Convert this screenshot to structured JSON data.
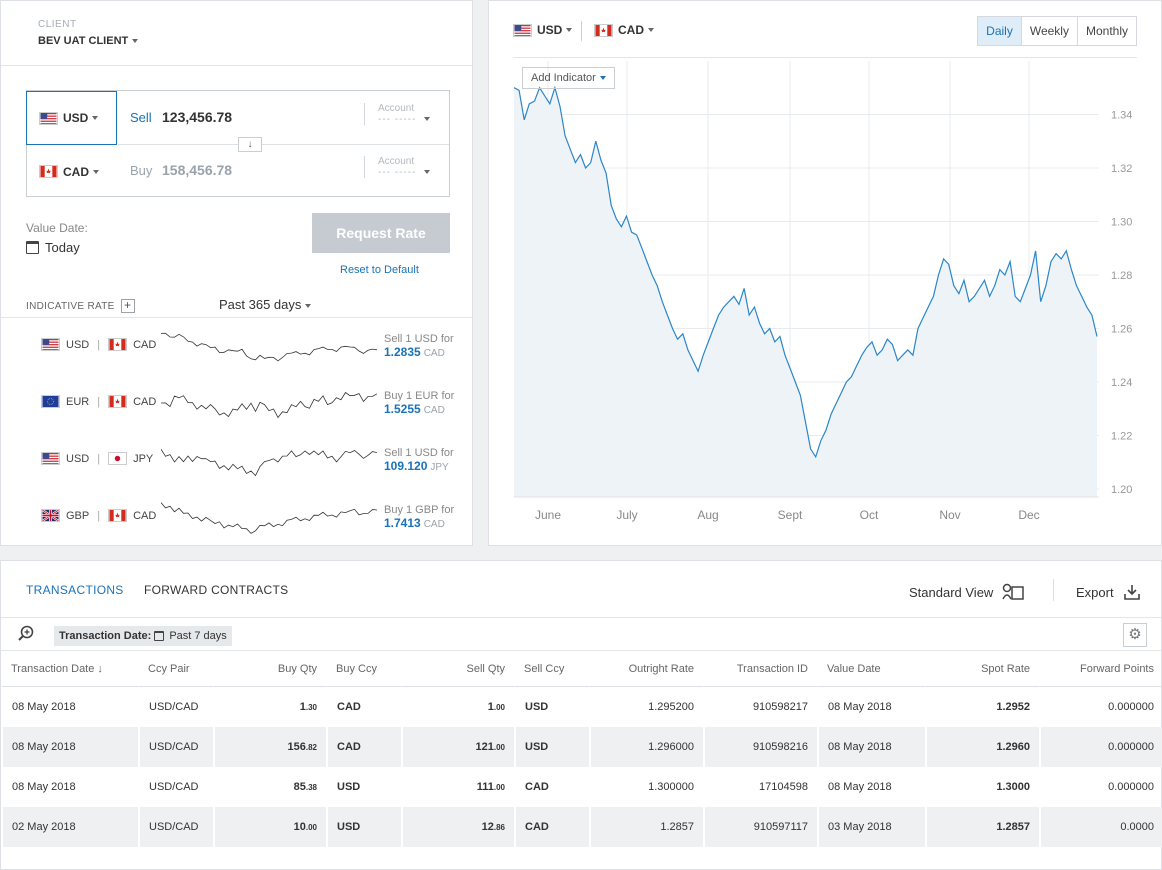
{
  "client": {
    "label": "CLIENT",
    "name": "BEV UAT CLIENT"
  },
  "trade": {
    "sell": {
      "ccy": "USD",
      "label": "Sell",
      "amount": "123,456.78",
      "account_label": "Account",
      "account_value": "--- -----"
    },
    "buy": {
      "ccy": "CAD",
      "label": "Buy",
      "amount": "158,456.78",
      "account_label": "Account",
      "account_value": "--- -----"
    },
    "swap_icon": "arrow-down-icon"
  },
  "value_date": {
    "label": "Value Date:",
    "value": "Today"
  },
  "request_rate": "Request Rate",
  "reset": "Reset to Default",
  "indicative": {
    "label": "INDICATIVE RATE",
    "period": "Past 365 days",
    "rows": [
      {
        "base": "USD",
        "quote": "CAD",
        "q1": "Sell 1 USD for",
        "rate": "1.2835",
        "unit": "CAD"
      },
      {
        "base": "EUR",
        "quote": "CAD",
        "q1": "Buy 1 EUR for",
        "rate": "1.5255",
        "unit": "CAD"
      },
      {
        "base": "USD",
        "quote": "JPY",
        "q1": "Sell 1 USD for",
        "rate": "109.120",
        "unit": "JPY"
      },
      {
        "base": "GBP",
        "quote": "CAD",
        "q1": "Buy 1 GBP for",
        "rate": "1.7413",
        "unit": "CAD"
      }
    ]
  },
  "chart_header": {
    "base": "USD",
    "quote": "CAD",
    "periods": [
      "Daily",
      "Weekly",
      "Monthly"
    ],
    "active_period": "Daily",
    "add_indicator": "Add Indicator"
  },
  "chart_data": {
    "type": "area",
    "x_labels": [
      "June",
      "July",
      "Aug",
      "Sept",
      "Oct",
      "Nov",
      "Dec"
    ],
    "y_ticks": [
      1.2,
      1.22,
      1.24,
      1.26,
      1.28,
      1.3,
      1.32,
      1.34
    ],
    "ylim": [
      1.197,
      1.36
    ],
    "series": [
      {
        "values": [
          1.35,
          1.349,
          1.338,
          1.344,
          1.345,
          1.35,
          1.347,
          1.344,
          1.35,
          1.343,
          1.332,
          1.327,
          1.322,
          1.325,
          1.32,
          1.322,
          1.33,
          1.323,
          1.318,
          1.306,
          1.301,
          1.298,
          1.302,
          1.296,
          1.295,
          1.29,
          1.285,
          1.28,
          1.276,
          1.27,
          1.265,
          1.26,
          1.256,
          1.258,
          1.252,
          1.248,
          1.244,
          1.25,
          1.255,
          1.26,
          1.265,
          1.268,
          1.27,
          1.272,
          1.269,
          1.275,
          1.265,
          1.268,
          1.262,
          1.258,
          1.26,
          1.255,
          1.257,
          1.25,
          1.245,
          1.24,
          1.235,
          1.225,
          1.215,
          1.212,
          1.218,
          1.222,
          1.228,
          1.232,
          1.236,
          1.24,
          1.242,
          1.246,
          1.25,
          1.253,
          1.255,
          1.25,
          1.252,
          1.256,
          1.254,
          1.248,
          1.25,
          1.252,
          1.25,
          1.26,
          1.264,
          1.268,
          1.272,
          1.28,
          1.286,
          1.284,
          1.276,
          1.273,
          1.278,
          1.27,
          1.272,
          1.275,
          1.278,
          1.272,
          1.276,
          1.282,
          1.28,
          1.285,
          1.272,
          1.27,
          1.275,
          1.28,
          1.289,
          1.27,
          1.276,
          1.285,
          1.288,
          1.286,
          1.289,
          1.282,
          1.276,
          1.272,
          1.268,
          1.265,
          1.257
        ]
      }
    ],
    "grid": true,
    "y_axis_position": "right"
  },
  "tx": {
    "tabs": [
      "TRANSACTIONS",
      "FORWARD CONTRACTS"
    ],
    "active_tab": "TRANSACTIONS",
    "standard_view": "Standard View",
    "export": "Export",
    "filter_label": "Transaction Date:",
    "filter_value": "Past 7 days",
    "columns": [
      "Transaction Date",
      "Ccy Pair",
      "Buy Qty",
      "Buy Ccy",
      "Sell Qty",
      "Sell Ccy",
      "Outright Rate",
      "Transaction ID",
      "Value Date",
      "Spot Rate",
      "Forward Points"
    ],
    "rows": [
      [
        "08 May 2018",
        "USD/CAD",
        [
          "1",
          ".30"
        ],
        "CAD",
        [
          "1",
          ".00"
        ],
        "USD",
        "1.295200",
        "910598217",
        "08 May 2018",
        "1.2952",
        "0.000000"
      ],
      [
        "08 May 2018",
        "USD/CAD",
        [
          "156",
          ".82"
        ],
        "CAD",
        [
          "121",
          ".00"
        ],
        "USD",
        "1.296000",
        "910598216",
        "08 May 2018",
        "1.2960",
        "0.000000"
      ],
      [
        "08 May 2018",
        "USD/CAD",
        [
          "85",
          ".38"
        ],
        "USD",
        [
          "111",
          ".00"
        ],
        "CAD",
        "1.300000",
        "17104598",
        "08 May 2018",
        "1.3000",
        "0.000000"
      ],
      [
        "02 May 2018",
        "USD/CAD",
        [
          "10",
          ".00"
        ],
        "USD",
        [
          "12",
          ".86"
        ],
        "CAD",
        "1.2857",
        "910597117",
        "03 May 2018",
        "1.2857",
        "0.0000"
      ]
    ]
  },
  "colors": {
    "accent": "#1a73b8",
    "line": "#2a86c9",
    "fill": "#eef3f8"
  }
}
